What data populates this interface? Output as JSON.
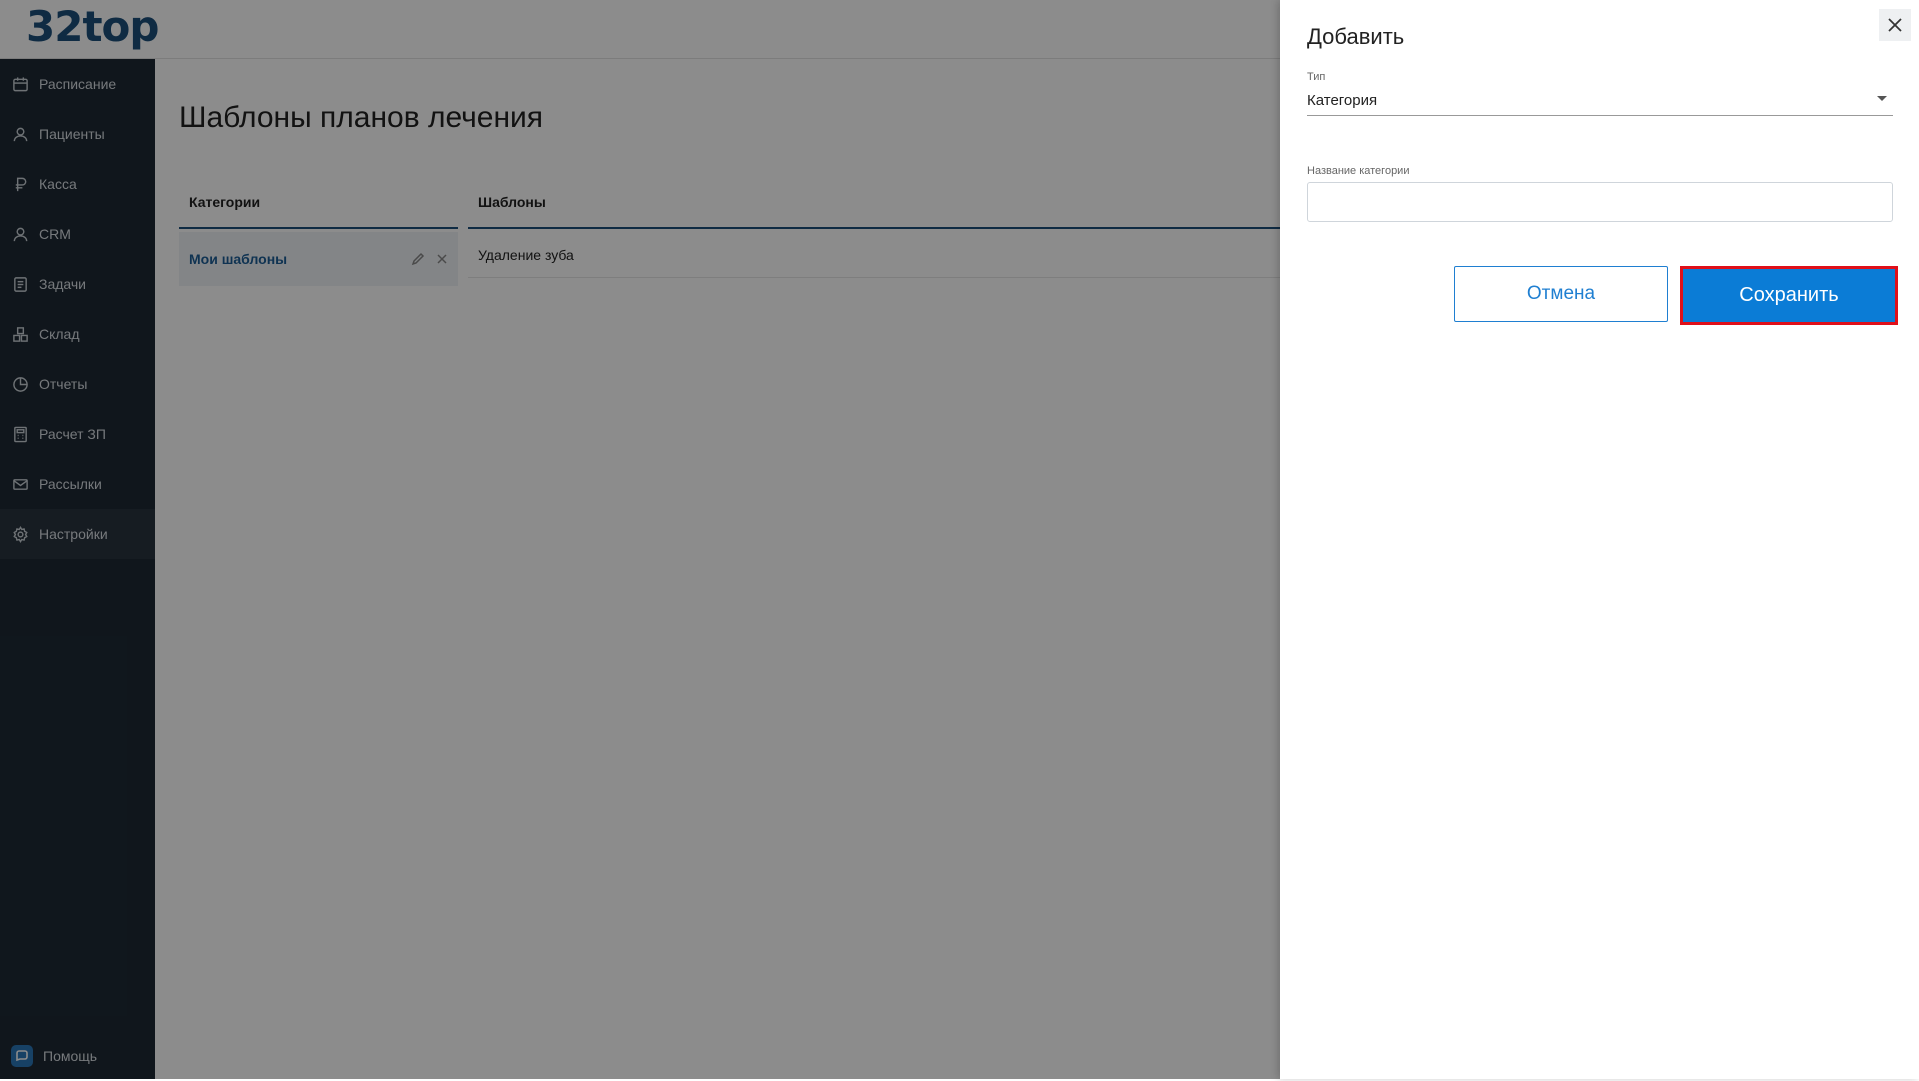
{
  "app": {
    "logo": "32top"
  },
  "sidebar": {
    "items": [
      {
        "label": "Расписание",
        "icon": "calendar-icon"
      },
      {
        "label": "Пациенты",
        "icon": "user-icon"
      },
      {
        "label": "Касса",
        "icon": "ruble-icon"
      },
      {
        "label": "CRM",
        "icon": "user-icon"
      },
      {
        "label": "Задачи",
        "icon": "checklist-icon"
      },
      {
        "label": "Склад",
        "icon": "boxes-icon"
      },
      {
        "label": "Отчеты",
        "icon": "pie-chart-icon"
      },
      {
        "label": "Расчет ЗП",
        "icon": "calculator-icon"
      },
      {
        "label": "Рассылки",
        "icon": "mail-icon"
      },
      {
        "label": "Настройки",
        "icon": "gear-icon"
      }
    ],
    "active": "Настройки",
    "help_label": "Помощь"
  },
  "main": {
    "title": "Шаблоны планов лечения",
    "categories_header": "Категории",
    "templates_header": "Шаблоны",
    "categories": [
      {
        "label": "Мои шаблоны"
      }
    ],
    "templates": [
      {
        "label": "Удаление зуба"
      }
    ]
  },
  "drawer": {
    "title": "Добавить",
    "type_label": "Тип",
    "type_value": "Категория",
    "name_label": "Название категории",
    "name_value": "",
    "cancel_label": "Отмена",
    "save_label": "Сохранить"
  },
  "colors": {
    "sidebar_bg": "#1e2934",
    "accent": "#0b7cd6",
    "highlight_border": "#e0101a",
    "logo": "#1d4f7a"
  }
}
